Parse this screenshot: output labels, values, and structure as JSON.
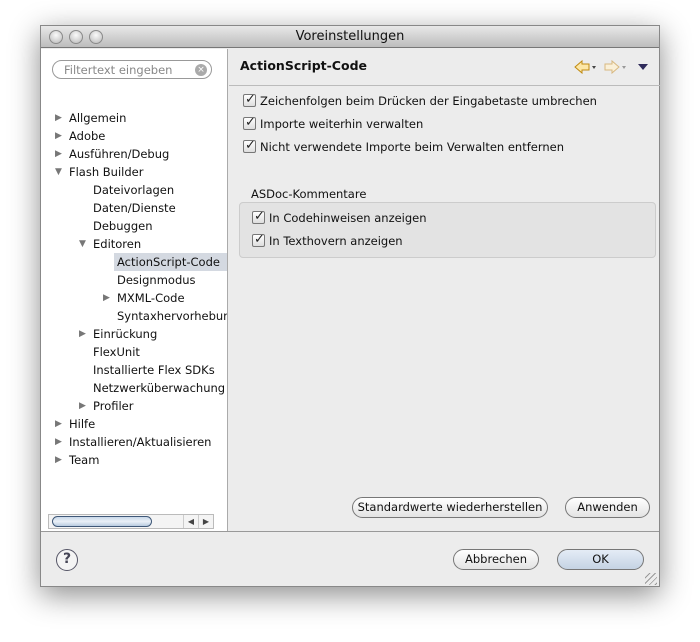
{
  "window": {
    "title": "Voreinstellungen"
  },
  "filter": {
    "placeholder": "Filtertext eingeben"
  },
  "tree": [
    {
      "label": "Allgemein",
      "level": 0,
      "arrow": "▶"
    },
    {
      "label": "Adobe",
      "level": 0,
      "arrow": "▶"
    },
    {
      "label": "Ausführen/Debug",
      "level": 0,
      "arrow": "▶"
    },
    {
      "label": "Flash Builder",
      "level": 0,
      "arrow": "▼"
    },
    {
      "label": "Dateivorlagen",
      "level": 1,
      "arrow": ""
    },
    {
      "label": "Daten/Dienste",
      "level": 1,
      "arrow": ""
    },
    {
      "label": "Debuggen",
      "level": 1,
      "arrow": ""
    },
    {
      "label": "Editoren",
      "level": 1,
      "arrow": "▼"
    },
    {
      "label": "ActionScript-Code",
      "level": 2,
      "arrow": "",
      "selected": true
    },
    {
      "label": "Designmodus",
      "level": 2,
      "arrow": ""
    },
    {
      "label": "MXML-Code",
      "level": 2,
      "arrow": "▶"
    },
    {
      "label": "Syntaxhervorhebung",
      "level": 2,
      "arrow": ""
    },
    {
      "label": "Einrückung",
      "level": 1,
      "arrow": "▶"
    },
    {
      "label": "FlexUnit",
      "level": 1,
      "arrow": ""
    },
    {
      "label": "Installierte Flex SDKs",
      "level": 1,
      "arrow": ""
    },
    {
      "label": "Netzwerküberwachung",
      "level": 1,
      "arrow": ""
    },
    {
      "label": "Profiler",
      "level": 1,
      "arrow": "▶"
    },
    {
      "label": "Hilfe",
      "level": 0,
      "arrow": "▶"
    },
    {
      "label": "Installieren/Aktualisieren",
      "level": 0,
      "arrow": "▶"
    },
    {
      "label": "Team",
      "level": 0,
      "arrow": "▶"
    }
  ],
  "page": {
    "title": "ActionScript-Code",
    "options": [
      "Zeichenfolgen beim Drücken der Eingabetaste umbrechen",
      "Importe weiterhin verwalten",
      "Nicht verwendete Importe beim Verwalten entfernen"
    ],
    "group_title": "ASDoc-Kommentare",
    "group_options": [
      "In Codehinweisen anzeigen",
      "In Texthovern anzeigen"
    ],
    "restore_defaults": "Standardwerte wiederherstellen",
    "apply": "Anwenden"
  },
  "footer": {
    "cancel": "Abbrechen",
    "ok": "OK"
  }
}
